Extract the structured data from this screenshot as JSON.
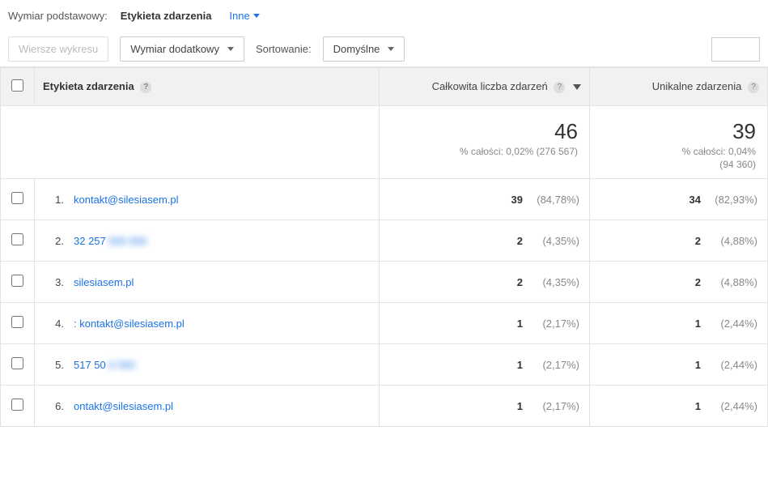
{
  "topbar": {
    "dim_primary_label": "Wymiar podstawowy:",
    "dim_value": "Etykieta zdarzenia",
    "other_label": "Inne"
  },
  "controls": {
    "chart_rows": "Wiersze wykresu",
    "secondary_dim": "Wymiar dodatkowy",
    "sort_label": "Sortowanie:",
    "sort_value": "Domyślne",
    "search_placeholder": ""
  },
  "headers": {
    "label": "Etykieta zdarzenia",
    "events": "Całkowita liczba zdarzeń",
    "unique": "Unikalne zdarzenia"
  },
  "summary": {
    "events_total": "46",
    "events_sub": "% całości: 0,02% (276 567)",
    "unique_total": "39",
    "unique_sub1": "% całości: 0,04%",
    "unique_sub2": "(94 360)"
  },
  "rows": [
    {
      "idx": "1.",
      "label": "kontakt@silesiasem.pl",
      "blur": "",
      "events_v": "39",
      "events_p": "(84,78%)",
      "unique_v": "34",
      "unique_p": "(82,93%)"
    },
    {
      "idx": "2.",
      "label": "32 257",
      "blur": "000 000",
      "events_v": "2",
      "events_p": "(4,35%)",
      "unique_v": "2",
      "unique_p": "(4,88%)"
    },
    {
      "idx": "3.",
      "label": "silesiasem.pl",
      "blur": "",
      "events_v": "2",
      "events_p": "(4,35%)",
      "unique_v": "2",
      "unique_p": "(4,88%)"
    },
    {
      "idx": "4.",
      "label": ": kontakt@silesiasem.pl",
      "blur": "",
      "events_v": "1",
      "events_p": "(2,17%)",
      "unique_v": "1",
      "unique_p": "(2,44%)"
    },
    {
      "idx": "5.",
      "label": "517 50",
      "blur": "0 000",
      "events_v": "1",
      "events_p": "(2,17%)",
      "unique_v": "1",
      "unique_p": "(2,44%)"
    },
    {
      "idx": "6.",
      "label": "ontakt@silesiasem.pl",
      "blur": "",
      "events_v": "1",
      "events_p": "(2,17%)",
      "unique_v": "1",
      "unique_p": "(2,44%)"
    }
  ]
}
